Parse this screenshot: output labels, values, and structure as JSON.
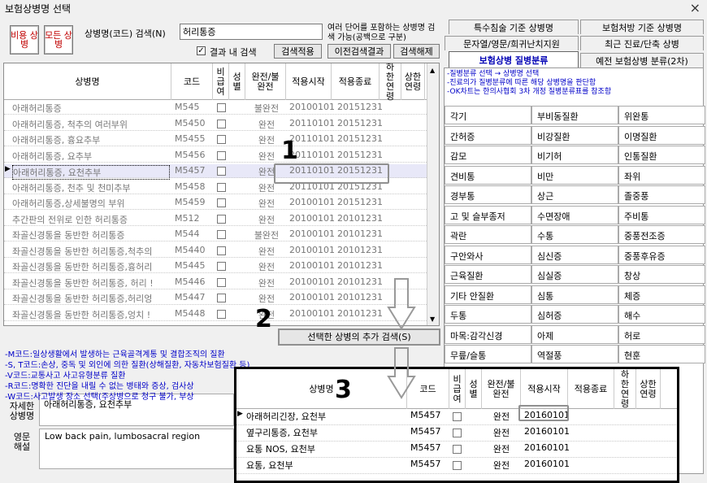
{
  "window": {
    "title": "보험상병명 선택",
    "close": "×"
  },
  "left_buttons": {
    "nonreimb": "비용 상병",
    "all": "모든 상병"
  },
  "search": {
    "label": "상병명(코드) 검색(N)",
    "value": "허리통증",
    "hint": "여러 단어를 포함하는 상병명 검색 가능(공백으로 구분)",
    "within_label": "결과 내 검색",
    "apply": "검색적용",
    "prev": "이전검색결과",
    "clear": "검색해제"
  },
  "table_headers": {
    "name": "상병명",
    "code": "코드",
    "nonreimb": "비급여",
    "sex": "성별",
    "complete": "완전/불완전",
    "start": "적용시작",
    "end": "적용종료",
    "lower_age": "하한연령",
    "upper_age": "상한연령"
  },
  "rows": [
    {
      "name": "아래허리통증",
      "code": "M545",
      "complete": "불완전",
      "start": "20100101",
      "end": "20151231"
    },
    {
      "name": "아래허리통증, 척추의 여러부위",
      "code": "M5450",
      "complete": "완전",
      "start": "20110101",
      "end": "20151231"
    },
    {
      "name": "아래허리통증, 흉요추부",
      "code": "M5455",
      "complete": "완전",
      "start": "20110101",
      "end": "20151231"
    },
    {
      "name": "아래허리통증, 요추부",
      "code": "M5456",
      "complete": "완전",
      "start": "20110101",
      "end": "20151231"
    },
    {
      "name": "아래허리통증, 요천추부",
      "code": "M5457",
      "complete": "완전",
      "start": "20110101",
      "end": "20151231"
    },
    {
      "name": "아래허리통증, 천추 및 천미추부",
      "code": "M5458",
      "complete": "완전",
      "start": "20110101",
      "end": "20151231"
    },
    {
      "name": "아래허리통증,상세불명의 부위",
      "code": "M5459",
      "complete": "완전",
      "start": "20100101",
      "end": "20151231"
    },
    {
      "name": "추간판의 전위로 인한 허리통증",
      "code": "M512",
      "complete": "완전",
      "start": "20100101",
      "end": "20101231"
    },
    {
      "name": "좌골신경통을 동반한 허리통증",
      "code": "M544",
      "complete": "불완전",
      "start": "20100101",
      "end": "20101231"
    },
    {
      "name": "좌골신경통을 동반한 허리통증,척추의",
      "code": "M5440",
      "complete": "완전",
      "start": "20100101",
      "end": "20101231"
    },
    {
      "name": "좌골신경통을 동반한 허리통증,흉허리",
      "code": "M5445",
      "complete": "완전",
      "start": "20100101",
      "end": "20101231"
    },
    {
      "name": "좌골신경통을 동반한 허리통증, 허리 !",
      "code": "M5446",
      "complete": "완전",
      "start": "20100101",
      "end": "20101231"
    },
    {
      "name": "좌골신경통을 동반한 허리통증,허리엉",
      "code": "M5447",
      "complete": "완전",
      "start": "20100101",
      "end": "20101231"
    },
    {
      "name": "좌골신경통을 동반한 허리통증,엉치 !",
      "code": "M5448",
      "complete": "완전",
      "start": "20100101",
      "end": "20101231"
    }
  ],
  "add_search_button": "선택한 상병의 추가 검색(S)",
  "legend": [
    "-M코드:일상생활에서 발생하는 근육골격계통 및 결합조직의 질환",
    "-S, T코드:손상, 중독 및 외인에 의한 질환(상해질환, 자동차보험질환 등)",
    "-V코드:교통사고 사고유형분류 질환",
    "-R코드:명확한 진단을 내릴 수 없는 병태와 증상, 검사상",
    "-W코드:사고발생 장소 선택(주상병으로 청구 불가, 부상"
  ],
  "detail": {
    "kr_label": "자세한 상병명",
    "kr_value": "아래허리통증, 요천추부",
    "en_label": "영문 해설",
    "en_value": "Low back pain, lumbosacral region"
  },
  "tabs": {
    "special": "특수침술 기준 상병명",
    "insurance_rx": "보험처방 기준 상병명",
    "string_search": "문자열/영문/희귀난치지원",
    "recent": "최근 진료/단축 상병",
    "disease_class": "보험상병 질병분류",
    "old_class": "예전 보험상병 분류(2차)"
  },
  "tab_notes": [
    "-질병분류 선택 → 상병명 선택",
    "-진료의가 질병분류에 따른 해당 상병명을 판단함",
    "-OK차트는 한의사협회 3차 개정 질병분류표를 참조함"
  ],
  "categories": [
    "각기",
    "부비동질환",
    "위완통",
    "간허증",
    "비강질환",
    "이명질환",
    "감모",
    "비기허",
    "인통질환",
    "견비통",
    "비만",
    "좌위",
    "경부통",
    "상근",
    "졸중풍",
    "고 및 슬부종저",
    "수면장애",
    "주비통",
    "곽란",
    "수통",
    "중풍전조증",
    "구안와사",
    "심신증",
    "중풍후유증",
    "근육질환",
    "심실증",
    "창상",
    "기타 안질환",
    "심통",
    "체증",
    "두통",
    "심허증",
    "해수",
    "마목:감각신경",
    "아제",
    "허로",
    "무릎/슬통",
    "역절풍",
    "현훈"
  ],
  "popup": {
    "headers": {
      "name": "상병명",
      "code": "코드",
      "nonreimb": "비급여",
      "sex": "성별",
      "complete": "완전/불완전",
      "start": "적용시작",
      "end": "적용종료",
      "lower_age": "하한연령",
      "upper_age": "상한연령"
    },
    "rows": [
      {
        "name": "아래허리긴장, 요천부",
        "code": "M5457",
        "complete": "완전",
        "start": "20160101"
      },
      {
        "name": "옆구리통증, 요천부",
        "code": "M5457",
        "complete": "완전",
        "start": "20160101"
      },
      {
        "name": "요통 NOS, 요천부",
        "code": "M5457",
        "complete": "완전",
        "start": "20160101"
      },
      {
        "name": "요통, 요천부",
        "code": "M5457",
        "complete": "완전",
        "start": "20160101"
      }
    ]
  },
  "annotations": {
    "one": "1",
    "two": "2",
    "three": "3"
  }
}
